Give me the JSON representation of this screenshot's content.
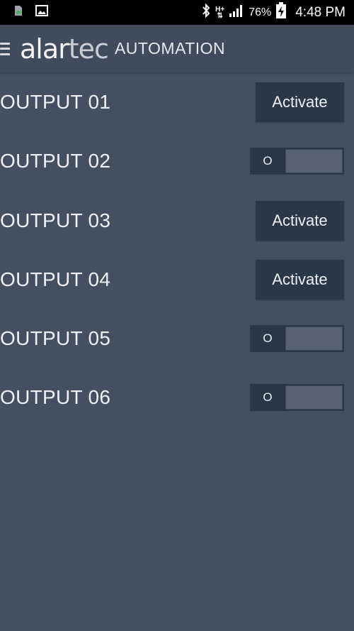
{
  "status_bar": {
    "left_icons": [
      "sd-card-icon",
      "image-icon"
    ],
    "network_label": "H+",
    "battery_percent": "76%",
    "time": "4:48 PM"
  },
  "header": {
    "brand_part1": "alar",
    "brand_part2": "tec",
    "title": "AUTOMATION"
  },
  "outputs": [
    {
      "label": "OUTPUT 01",
      "control": "button",
      "button_label": "Activate"
    },
    {
      "label": "OUTPUT 02",
      "control": "toggle",
      "state_label": "O"
    },
    {
      "label": "OUTPUT 03",
      "control": "button",
      "button_label": "Activate"
    },
    {
      "label": "OUTPUT 04",
      "control": "button",
      "button_label": "Activate"
    },
    {
      "label": "OUTPUT 05",
      "control": "toggle",
      "state_label": "O"
    },
    {
      "label": "OUTPUT 06",
      "control": "toggle",
      "state_label": "O"
    }
  ],
  "colors": {
    "background": "#435062",
    "header": "#3f4c5d",
    "button": "#283849",
    "toggle_track": "#566273"
  }
}
